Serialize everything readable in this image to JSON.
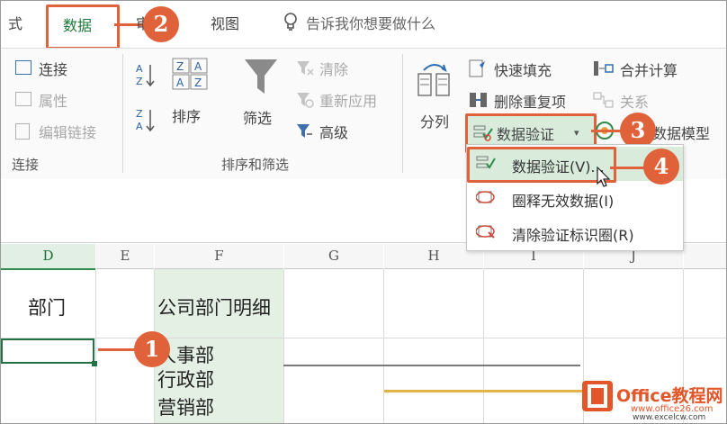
{
  "tabs": {
    "partial_left": "式",
    "data": "数据",
    "review_partial": "审",
    "view": "视图",
    "tell_me": "告诉我你想要做什么"
  },
  "ribbon": {
    "connections": {
      "connect": "连接",
      "properties": "属性",
      "edit_links": "编辑链接",
      "group_label": "连接"
    },
    "sort_filter": {
      "sort": "排序",
      "filter": "筛选",
      "clear": "清除",
      "reapply": "重新应用",
      "advanced": "高级",
      "group_label": "排序和筛选"
    },
    "tools": {
      "text_to_columns": "分列",
      "flash_fill": "快速填充",
      "remove_duplicates": "删除重复项",
      "data_validation": "数据验证",
      "consolidate": "合并计算",
      "relationships": "关系",
      "data_model": "数据模型"
    }
  },
  "dropdown": {
    "items": [
      {
        "label": "数据验证(V)..."
      },
      {
        "label": "圈释无效数据(I)"
      },
      {
        "label": "清除验证标识圈(R)"
      }
    ]
  },
  "sheet": {
    "columns": [
      "D",
      "E",
      "F",
      "G",
      "H",
      "I",
      "J"
    ],
    "cells": {
      "d_header": "部门",
      "f_header": "公司部门明细",
      "f_rows": [
        "人事部",
        "行政部",
        "营销部"
      ]
    }
  },
  "callouts": [
    "1",
    "2",
    "3",
    "4"
  ],
  "watermark": {
    "brand": "Office教程网",
    "url": "www.office26.com",
    "url2": "www.excelcw.com"
  },
  "colors": {
    "accent_orange": "#e0623a",
    "excel_green": "#1f7a3a"
  }
}
